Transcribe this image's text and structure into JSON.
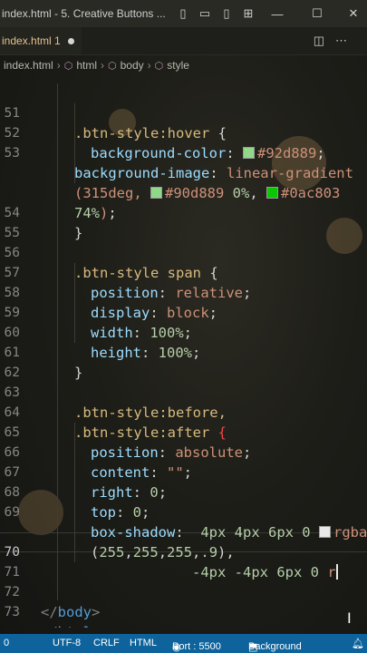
{
  "titlebar": {
    "title": "index.html - 5. Creative Buttons ...",
    "icons": [
      "layout-sidebar-icon",
      "layout-panel-icon",
      "layout-sidebar-right-icon",
      "layout-grid-icon"
    ]
  },
  "tab": {
    "label": "index.html 1"
  },
  "breadcrumb": [
    "index.html",
    "html",
    "body",
    "style"
  ],
  "editor": {
    "lines": [
      {
        "n": "51",
        "text": ".btn-style:hover {"
      },
      {
        "n": "52",
        "text": "background-color: #92d889;",
        "swatch": "#92d889"
      },
      {
        "n": "53",
        "text": "background-image: linear-gradient"
      },
      {
        "n": "",
        "text": "(315deg, #90d889 0%, #0ac803"
      },
      {
        "n": "",
        "text": "74%);"
      },
      {
        "n": "54",
        "text": "}"
      },
      {
        "n": "55",
        "text": ""
      },
      {
        "n": "56",
        "text": ".btn-style span {"
      },
      {
        "n": "57",
        "text": "position: relative;"
      },
      {
        "n": "58",
        "text": "display: block;"
      },
      {
        "n": "59",
        "text": "width: 100%;"
      },
      {
        "n": "60",
        "text": "height: 100%;"
      },
      {
        "n": "61",
        "text": "}"
      },
      {
        "n": "62",
        "text": ""
      },
      {
        "n": "63",
        "text": ".btn-style:before,"
      },
      {
        "n": "64",
        "text": ".btn-style:after {"
      },
      {
        "n": "65",
        "text": "position: absolute;"
      },
      {
        "n": "66",
        "text": "content: \"\";"
      },
      {
        "n": "67",
        "text": "right: 0;"
      },
      {
        "n": "68",
        "text": "top: 0;"
      },
      {
        "n": "69",
        "text": "box-shadow:  4px 4px 6px 0 rgba"
      },
      {
        "n": "",
        "text": "(255,255,255,.9),"
      },
      {
        "n": "70",
        "text": "-4px -4px 6px 0 r"
      },
      {
        "n": "71",
        "text": ""
      },
      {
        "n": "72",
        "text": "</body>"
      },
      {
        "n": "73",
        "text": "</html>"
      }
    ],
    "swatches": {
      "c92d889": "#92d889",
      "c90d889": "#90d889",
      "c0ac803": "#0ac803",
      "white": "#ffffff"
    }
  },
  "statusbar": {
    "left": "0",
    "encoding": "UTF-8",
    "eol": "CRLF",
    "language": "HTML",
    "port": "Port : 5500",
    "background": "Background",
    "bell": "bell-icon"
  },
  "colors": {
    "accent": "#0e639c",
    "selector": "#d7ba7d",
    "property": "#9cdcfe",
    "value": "#ce9178",
    "number": "#b5cea8"
  }
}
